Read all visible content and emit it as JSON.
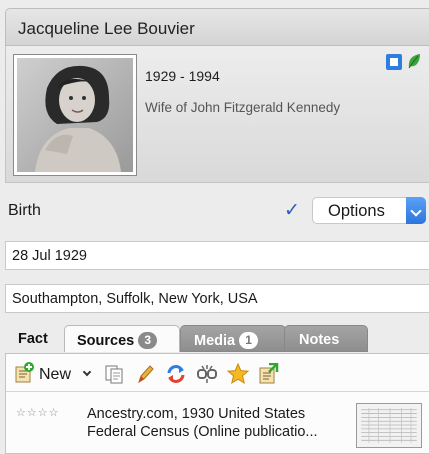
{
  "person": {
    "name": "Jacqueline Lee Bouvier",
    "years": "1929 - 1994",
    "description": "Wife of John Fitzgerald Kennedy"
  },
  "event": {
    "label": "Birth",
    "options_label": "Options",
    "date": "28 Jul 1929",
    "place": "Southampton, Suffolk, New York, USA"
  },
  "tabs": [
    {
      "label": "Fact"
    },
    {
      "label": "Sources",
      "count": "3"
    },
    {
      "label": "Media",
      "count": "1"
    },
    {
      "label": "Notes"
    }
  ],
  "toolbar": {
    "new_label": "New",
    "icons": [
      "add-source-icon",
      "copy-icon",
      "edit-icon",
      "merge-icon",
      "unlink-icon",
      "star-icon",
      "export-icon"
    ]
  },
  "sources": [
    {
      "stars": "☆☆☆☆",
      "line1": "Ancestry.com, 1930 United States",
      "line2": "Federal Census (Online publicatio..."
    }
  ],
  "colors": {
    "accent": "#2c75de",
    "checkmark": "#2c5fb8",
    "inactive_tab": "#9a9a9a",
    "leaf": "#3aa53a"
  }
}
